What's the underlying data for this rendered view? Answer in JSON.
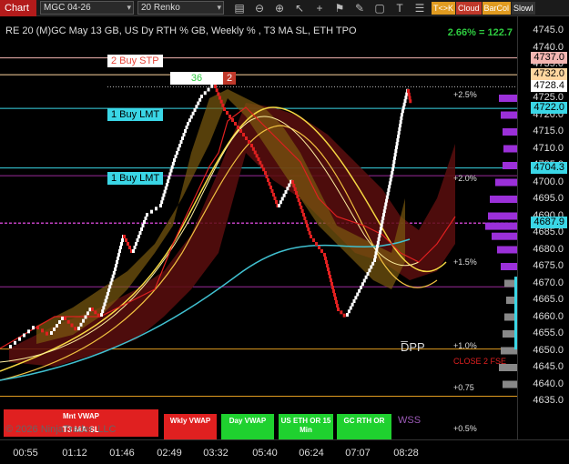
{
  "toolbar": {
    "title": "Chart",
    "instrument": "MGC 04-26",
    "bar_type": "20 Renko",
    "tools": [
      "chart-icon",
      "zoom-out-icon",
      "zoom-in-icon",
      "cursor-icon",
      "crosshair-icon",
      "flag-icon",
      "pen-icon",
      "box-icon",
      "text-icon",
      "properties-icon"
    ],
    "buttons": [
      {
        "label": "T<>K",
        "color": "#e09b20"
      },
      {
        "label": "Cloud",
        "color": "#c0392b"
      },
      {
        "label": "BarCol",
        "color": "#e09b20"
      },
      {
        "label": "Slowl",
        "color": "#333"
      }
    ]
  },
  "header": {
    "text": "RE 20  (M)GC May 13 GB, US Dy RTH % GB, Weekly % , T3 MA SL, ETH TPO",
    "pct": "2.66% = 122.7"
  },
  "orders": [
    {
      "label": "2 Buy STP",
      "price": "4737.0",
      "bg": "#ffffff",
      "fg": "#e7463b",
      "color": "#f4b6b2"
    },
    {
      "label": "1 Buy LMT",
      "price": "4722.0",
      "bg": "#3ad6e6",
      "fg": "#000",
      "color": "#3ad6e6"
    },
    {
      "label": "1 Buy LMT",
      "price": "4704.3",
      "bg": "#3ad6e6",
      "fg": "#000",
      "color": "#3ad6e6"
    }
  ],
  "position": {
    "qty": "36",
    "qty2": "2"
  },
  "price_axis": {
    "ticks": [
      "4745.0",
      "4740.0",
      "4735.0",
      "4730.0",
      "4725.0",
      "4720.0",
      "4715.0",
      "4710.0",
      "4705.0",
      "4700.0",
      "4695.0",
      "4690.0",
      "4685.0",
      "4680.0",
      "4675.0",
      "4670.0",
      "4665.0",
      "4660.0",
      "4655.0",
      "4650.0",
      "4645.0",
      "4640.0",
      "4635.0"
    ],
    "labels": [
      {
        "text": "4737.0",
        "bg": "#f4b6b2",
        "fg": "#000"
      },
      {
        "text": "4732.0",
        "bg": "#ffd7a0",
        "fg": "#000"
      },
      {
        "text": "4728.4",
        "bg": "#fff",
        "fg": "#000"
      },
      {
        "text": "4722.0",
        "bg": "#3ad6e6",
        "fg": "#000"
      },
      {
        "text": "4704.3",
        "bg": "#3ad6e6",
        "fg": "#000"
      },
      {
        "text": "4687.9",
        "bg": "#3ad6e6",
        "fg": "#000"
      }
    ]
  },
  "pct_levels": [
    "+2.5%",
    "+2.0%",
    "+1.5%",
    "+1.0%",
    "+0.75",
    "+0.5%"
  ],
  "annotations": {
    "dpp": "D̅PP",
    "close": "CLOSE 2 FSE",
    "wss": "WSS"
  },
  "buttons": [
    {
      "line1": "Mnt VWAP",
      "line2": "T3 MA SL",
      "color": "#e02020"
    },
    {
      "line1": "Wkly VWAP",
      "line2": "",
      "color": "#e02020"
    },
    {
      "line1": "Day VWAP",
      "line2": "",
      "color": "#1fd12f"
    },
    {
      "line1": "US ETH OR 15",
      "line2": "Min",
      "color": "#1fd12f"
    },
    {
      "line1": "GC RTH OR",
      "line2": "",
      "color": "#1fd12f"
    }
  ],
  "copyright": "© 2026 NinjaTrader, LLC",
  "time_axis": [
    "00:55",
    "01:12",
    "01:46",
    "02:49",
    "03:32",
    "05:40",
    "06:24",
    "07:07",
    "08:28"
  ]
}
